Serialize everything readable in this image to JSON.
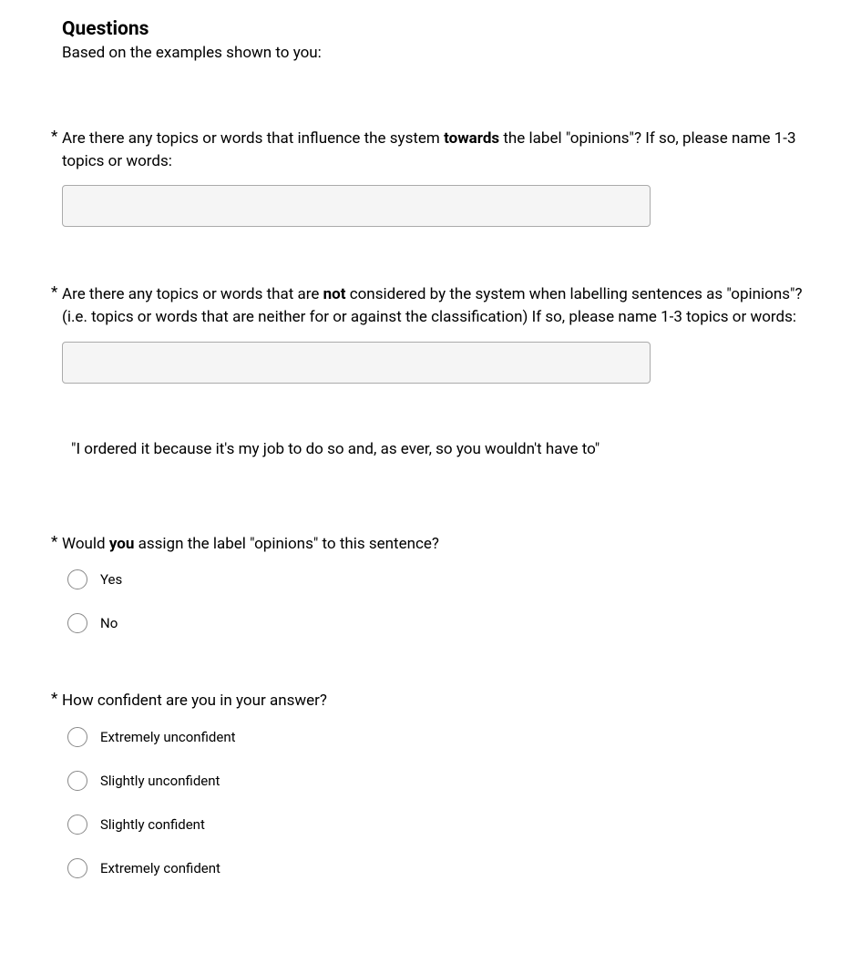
{
  "heading": "Questions",
  "subheading": "Based on the examples shown to you:",
  "asterisk": "*",
  "q1": {
    "prefix": "Are there any topics or words that influence the system ",
    "bold": "towards",
    "suffix": " the label \"opinions\"? If so, please name 1-3 topics or words:"
  },
  "q2": {
    "prefix": "Are there any topics or words that are ",
    "bold": "not",
    "suffix": " considered by the system when labelling sentences as \"opinions\"? (i.e. topics or words that are neither for or against the classification) If so, please name 1-3 topics or words:"
  },
  "quote": "\"I ordered it because it's my job to do so and, as ever, so you wouldn't have to\"",
  "q3": {
    "prefix": "Would ",
    "bold": "you",
    "suffix": " assign the label \"opinions\" to this sentence?",
    "options": [
      "Yes",
      "No"
    ]
  },
  "q4": {
    "text": "How confident are you in your answer?",
    "options": [
      "Extremely unconfident",
      "Slightly unconfident",
      "Slightly confident",
      "Extremely confident"
    ]
  }
}
